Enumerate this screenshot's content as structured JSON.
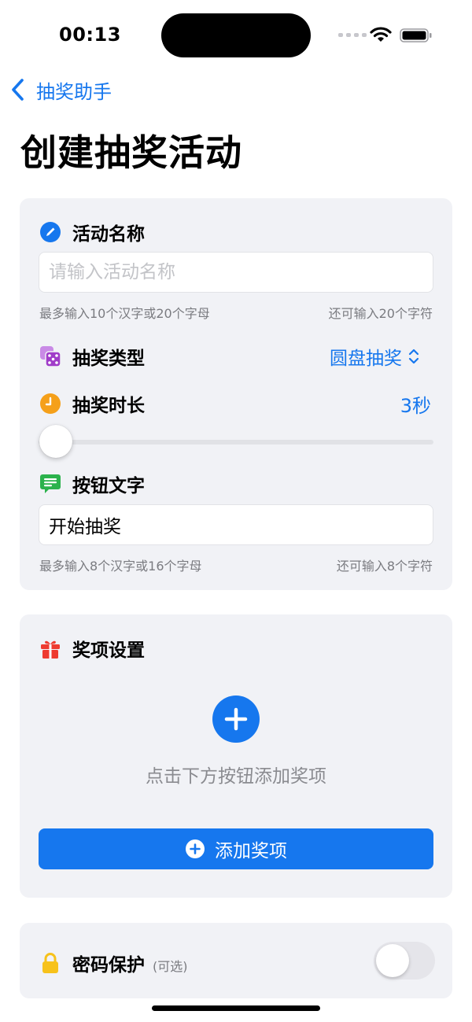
{
  "status_bar": {
    "time": "00:13"
  },
  "nav": {
    "back_label": "抽奖助手",
    "title": "创建抽奖活动"
  },
  "activity_name": {
    "label": "活动名称",
    "placeholder": "请输入活动名称",
    "value": "",
    "hint_left": "最多输入10个汉字或20个字母",
    "hint_right": "还可输入20个字符"
  },
  "lottery_type": {
    "label": "抽奖类型",
    "value": "圆盘抽奖"
  },
  "duration": {
    "label": "抽奖时长",
    "value": "3秒",
    "slider_fraction": 0.0
  },
  "button_text": {
    "label": "按钮文字",
    "value": "开始抽奖",
    "hint_left": "最多输入8个汉字或16个字母",
    "hint_right": "还可输入8个字符"
  },
  "prizes": {
    "label": "奖项设置",
    "empty_text": "点击下方按钮添加奖项",
    "add_button_label": "添加奖项"
  },
  "password": {
    "label": "密码保护",
    "optional": "(可选)",
    "enabled": false
  },
  "colors": {
    "accent": "#1677ee",
    "card_bg": "#f1f2f6",
    "hint": "#7a7b80"
  },
  "icons": [
    "chevron-left-icon",
    "pencil-icon",
    "dice-icon",
    "clock-icon",
    "message-icon",
    "gift-icon",
    "plus-icon",
    "lock-icon",
    "chevron-updown-icon"
  ]
}
